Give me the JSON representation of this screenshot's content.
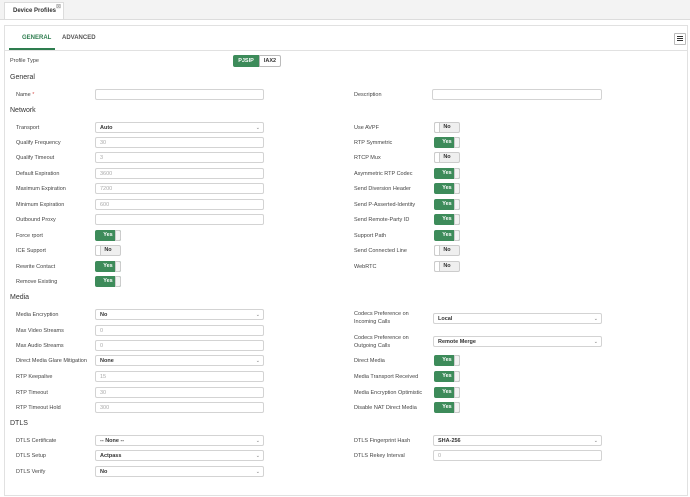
{
  "window": {
    "tab_title": "Device Profiles",
    "close_glyph": "⊠"
  },
  "tabs": [
    {
      "label": "GENERAL"
    },
    {
      "label": "ADVANCED"
    }
  ],
  "menu_icon": "hamburger-menu-icon",
  "profile_type": {
    "label": "Profile Type",
    "options": [
      "PJSIP",
      "IAX2"
    ],
    "selected": "PJSIP"
  },
  "sections": {
    "general": "General",
    "network": "Network",
    "media": "Media",
    "dtls": "DTLS"
  },
  "general": {
    "name": {
      "label": "Name",
      "required_mark": "*",
      "value": ""
    },
    "description": {
      "label": "Description",
      "value": ""
    }
  },
  "network": {
    "transport": {
      "label": "Transport",
      "value": "Auto"
    },
    "qualify_frequency": {
      "label": "Qualify Frequency",
      "placeholder": "30"
    },
    "qualify_timeout": {
      "label": "Qualify Timeout",
      "placeholder": "3"
    },
    "default_expiration": {
      "label": "Default Expiration",
      "placeholder": "3600"
    },
    "maximum_expiration": {
      "label": "Maximum Expiration",
      "placeholder": "7200"
    },
    "minimum_expiration": {
      "label": "Minimum Expiration",
      "placeholder": "600"
    },
    "outbound_proxy": {
      "label": "Outbound Proxy",
      "placeholder": ""
    },
    "force_rport": {
      "label": "Force rport",
      "value": "Yes"
    },
    "ice_support": {
      "label": "ICE Support",
      "value": "No"
    },
    "rewrite_contact": {
      "label": "Rewrite Contact",
      "value": "Yes"
    },
    "remove_existing": {
      "label": "Remove Existing",
      "value": "Yes"
    },
    "use_avpf": {
      "label": "Use AVPF",
      "value": "No"
    },
    "rtp_symmetric": {
      "label": "RTP Symmetric",
      "value": "Yes"
    },
    "rtcp_mux": {
      "label": "RTCP Mux",
      "value": "No"
    },
    "asymmetric_rtp_codec": {
      "label": "Asymmetric RTP Codec",
      "value": "Yes"
    },
    "send_diversion_header": {
      "label": "Send Diversion Header",
      "value": "Yes"
    },
    "send_p_asserted_identity": {
      "label": "Send P-Asserted-Identity",
      "value": "Yes"
    },
    "send_remote_party_id": {
      "label": "Send Remote-Party ID",
      "value": "Yes"
    },
    "support_path": {
      "label": "Support Path",
      "value": "Yes"
    },
    "send_connected_line": {
      "label": "Send Connected Line",
      "value": "No"
    },
    "webrtc": {
      "label": "WebRTC",
      "value": "No"
    }
  },
  "media": {
    "media_encryption": {
      "label": "Media Encryption",
      "value": "No"
    },
    "max_video_streams": {
      "label": "Max Video Streams",
      "placeholder": "0"
    },
    "max_audio_streams": {
      "label": "Max Audio Streams",
      "placeholder": "0"
    },
    "direct_media_glare": {
      "label": "Direct Media Glare Mitigation",
      "value": "None"
    },
    "rtp_keepalive": {
      "label": "RTP Keepalive",
      "placeholder": "15"
    },
    "rtp_timeout": {
      "label": "RTP Timeout",
      "placeholder": "30"
    },
    "rtp_timeout_hold": {
      "label": "RTP Timeout Hold",
      "placeholder": "300"
    },
    "codecs_incoming": {
      "label": "Codecs Preference on Incoming Calls",
      "value": "Local"
    },
    "codecs_outgoing": {
      "label": "Codecs Preference on Outgoing Calls",
      "value": "Remote Merge"
    },
    "direct_media": {
      "label": "Direct Media",
      "value": "Yes"
    },
    "media_transport_received": {
      "label": "Media Transport Received",
      "value": "Yes"
    },
    "media_encryption_optimistic": {
      "label": "Media Encryption Optimistic",
      "value": "Yes"
    },
    "disable_nat_direct_media": {
      "label": "Disable NAT Direct Media",
      "value": "Yes"
    }
  },
  "dtls": {
    "certificate": {
      "label": "DTLS Certificate",
      "value": "-- None --"
    },
    "setup": {
      "label": "DTLS Setup",
      "value": "Actpass"
    },
    "verify": {
      "label": "DTLS Verify",
      "value": "No"
    },
    "fingerprint_hash": {
      "label": "DTLS Fingerprint Hash",
      "value": "SHA-256"
    },
    "rekey_interval": {
      "label": "DTLS Rekey Interval",
      "placeholder": "0"
    }
  }
}
